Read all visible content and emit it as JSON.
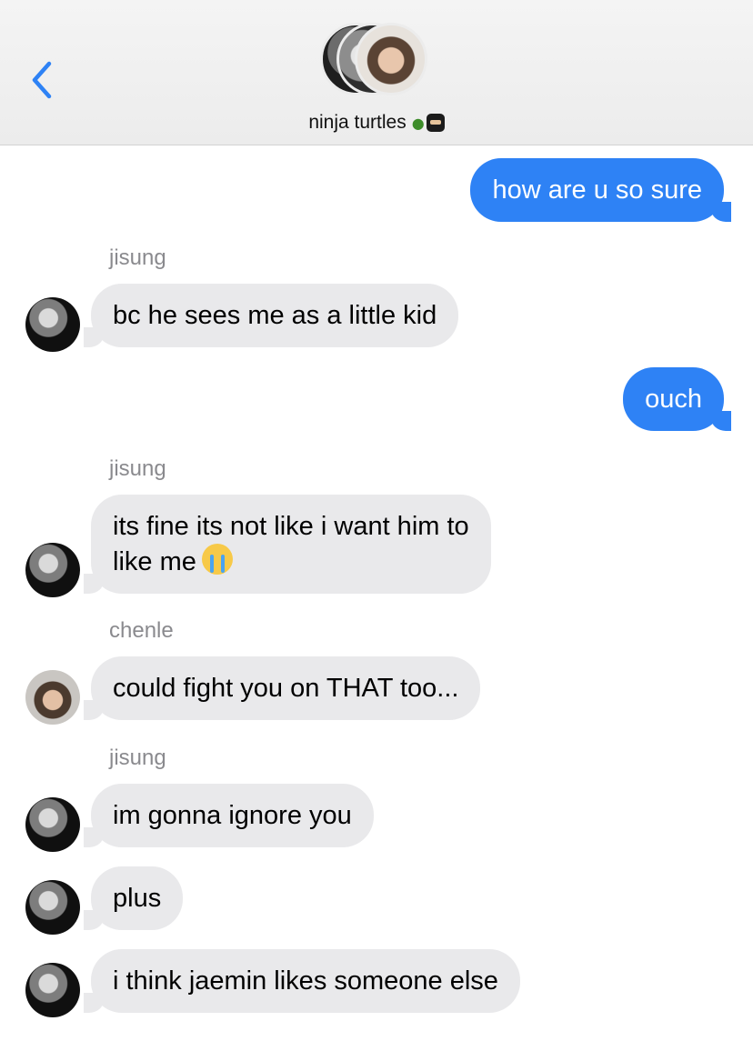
{
  "header": {
    "title": "ninja turtles",
    "title_emojis": [
      "turtle-emoji",
      "ninja-emoji"
    ],
    "back_icon": "chevron-left-icon",
    "accent_color": "#2e82f5"
  },
  "messages": [
    {
      "direction": "outgoing",
      "text": "how are u so sure"
    },
    {
      "direction": "incoming",
      "sender": "jisung",
      "text": "bc he sees me as a little kid"
    },
    {
      "direction": "outgoing",
      "text": "ouch"
    },
    {
      "direction": "incoming",
      "sender": "jisung",
      "line1": "its fine its not like i want him to",
      "line2": "like me",
      "emoji": "loudly-crying-face-emoji"
    },
    {
      "direction": "incoming",
      "sender": "chenle",
      "text": "could fight you on THAT too..."
    },
    {
      "direction": "incoming",
      "sender": "jisung",
      "text": "im gonna ignore you"
    },
    {
      "direction": "incoming",
      "text": "plus"
    },
    {
      "direction": "incoming",
      "text": "i think jaemin likes someone else"
    }
  ],
  "colors": {
    "outgoing_bubble": "#2e82f5",
    "incoming_bubble": "#e9e9eb",
    "sender_label": "#8a8a8e"
  }
}
